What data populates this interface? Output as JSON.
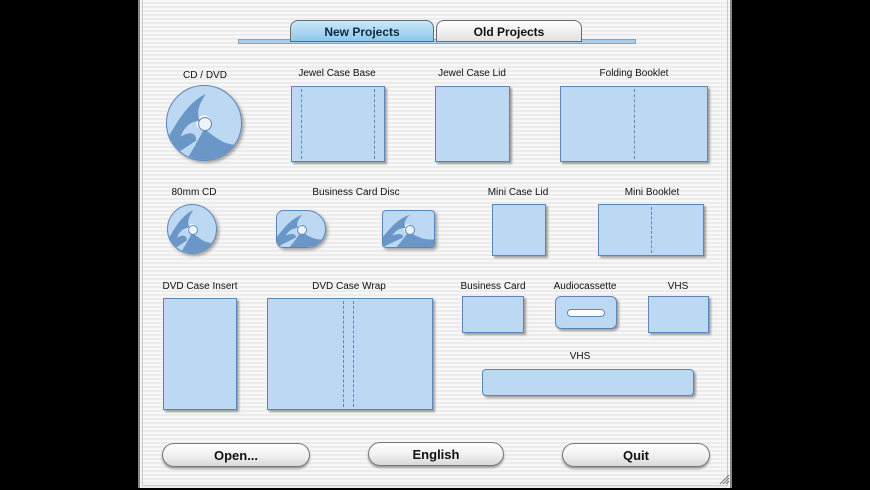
{
  "tabs": {
    "new_label": "New Projects",
    "old_label": "Old Projects"
  },
  "labels": {
    "cd_dvd": "CD / DVD",
    "jewel_case_base": "Jewel Case Base",
    "jewel_case_lid": "Jewel Case Lid",
    "folding_booklet": "Folding Booklet",
    "mm80_cd": "80mm CD",
    "business_card_disc": "Business Card Disc",
    "mini_case_lid": "Mini Case Lid",
    "mini_booklet": "Mini Booklet",
    "dvd_case_insert": "DVD Case Insert",
    "dvd_case_wrap": "DVD Case Wrap",
    "business_card": "Business Card",
    "audiocassette": "Audiocassette",
    "vhs_small": "VHS",
    "vhs_spine": "VHS"
  },
  "buttons": {
    "open": "Open...",
    "language": "English",
    "quit": "Quit"
  },
  "colors": {
    "item_fill": "#bcd8f2",
    "item_border": "#5d86b8",
    "disc_art": "#6b97c8",
    "tab_active": "#9fd0ee"
  }
}
